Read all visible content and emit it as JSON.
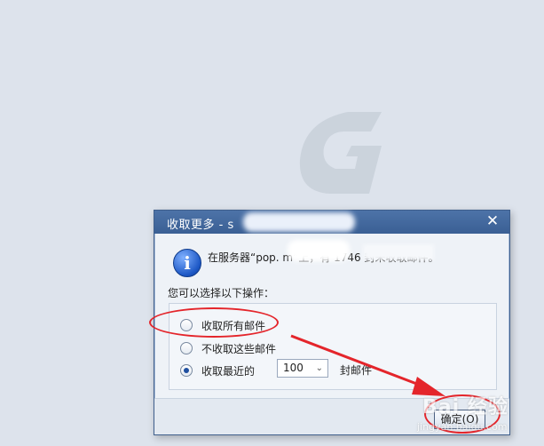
{
  "dialog": {
    "title": "收取更多 - s",
    "close_glyph": "✕",
    "message": "在服务器“pop.                    m”上，有 1746 封未收取邮件。",
    "prompt": "您可以选择以下操作：",
    "options": [
      {
        "label": "收取所有邮件",
        "checked": false
      },
      {
        "label": "不收取这些邮件",
        "checked": false
      },
      {
        "label": "收取最近的",
        "checked": true
      }
    ],
    "count_select": {
      "value": "100",
      "chevron": "⌄"
    },
    "count_suffix": "封邮件",
    "ok_label": "确定(O)"
  },
  "info_icon_glyph": "i",
  "watermark": {
    "text": "Bai 经验",
    "sub": "jingyan.baidu.com"
  },
  "colors": {
    "annotation": "#e4252b",
    "titlebar": "#3a5f94",
    "background": "#dde3ec"
  }
}
